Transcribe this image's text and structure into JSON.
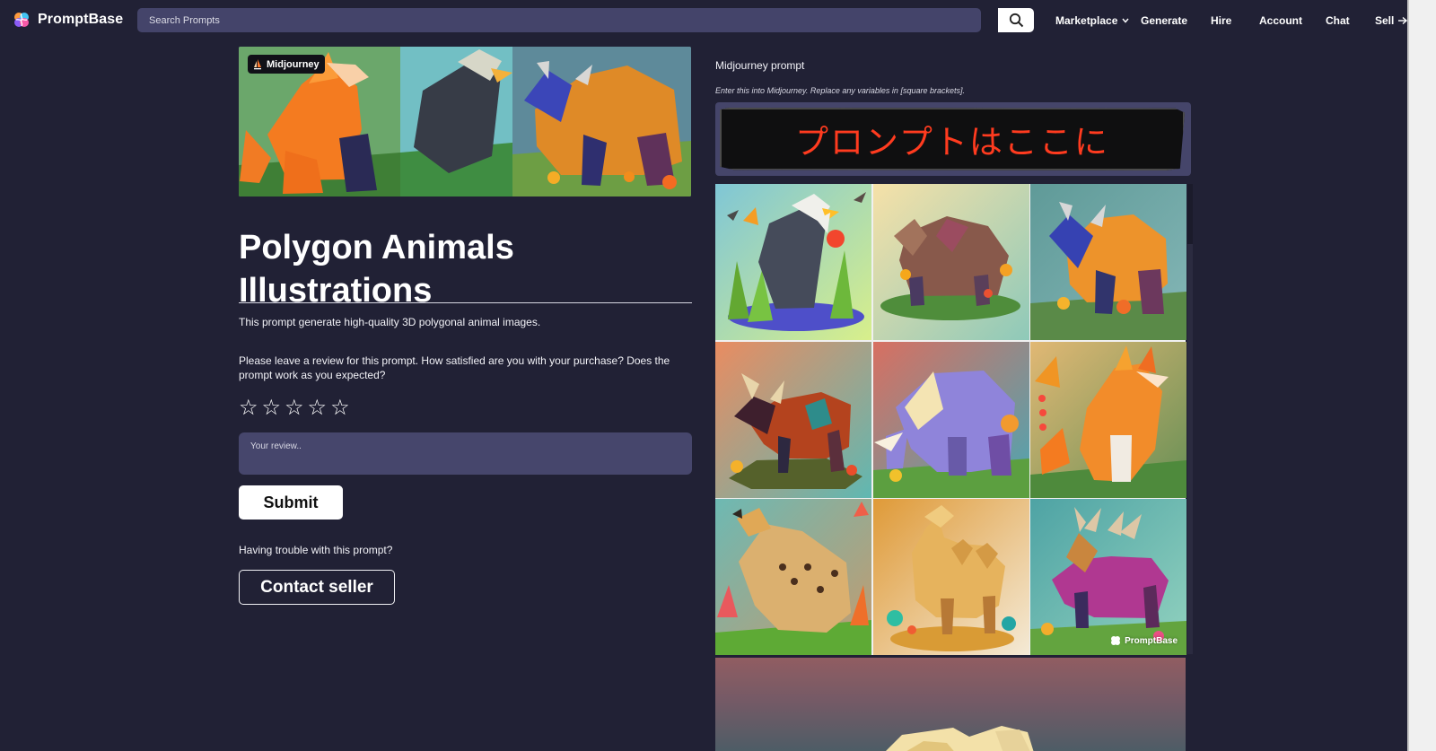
{
  "brand": {
    "name": "PromptBase"
  },
  "search": {
    "placeholder": "Search Prompts"
  },
  "nav": {
    "marketplace": "Marketplace",
    "generate": "Generate",
    "hire": "Hire",
    "account": "Account",
    "chat": "Chat",
    "sell": "Sell"
  },
  "listing": {
    "badge": "Midjourney",
    "title_line1": "Polygon Animals",
    "title_line2": "Illustrations",
    "description": "This prompt generate high-quality 3D polygonal animal images.",
    "review_question": "Please leave a review for this prompt. How satisfied are you with your purchase? Does the prompt work as you expected?",
    "review_placeholder": "Your review..",
    "submit_label": "Submit",
    "trouble_text": "Having trouble with this prompt?",
    "contact_label": "Contact seller",
    "rating_max": 5,
    "rating_value": 0
  },
  "prompt": {
    "label": "Midjourney prompt",
    "hint": "Enter this into Midjourney. Replace any variables in [square brackets].",
    "text": "プロンプトはここに"
  },
  "gallery": {
    "watermark": "PromptBase",
    "tiles": [
      "eagle",
      "bear",
      "bison",
      "bull",
      "elephant",
      "fox",
      "cheetah",
      "camel",
      "deer"
    ]
  },
  "icons": {
    "search": "search-icon",
    "dropdown": "chevron-down-icon",
    "sell": "arrow-right-icon",
    "star": "star-outline-icon",
    "logo": "brain-logo-icon"
  },
  "colors": {
    "background": "#212135",
    "search": "#44446a",
    "prompt_text": "#ff3b1f"
  }
}
